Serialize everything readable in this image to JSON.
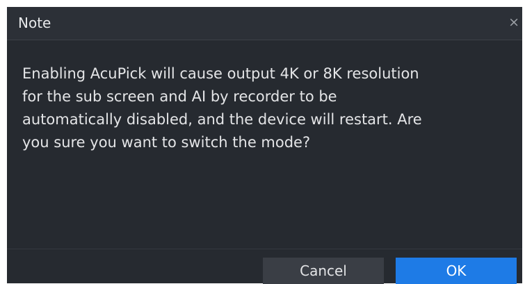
{
  "dialog": {
    "title": "Note",
    "close_symbol": "×",
    "message_lines": [
      "Enabling AcuPick will cause output 4K or 8K resolution",
      "for the sub screen and AI by recorder to be",
      "automatically disabled, and the device will restart. Are",
      "you sure you want to switch the mode?"
    ],
    "buttons": {
      "cancel_label": "Cancel",
      "ok_label": "OK"
    }
  },
  "colors": {
    "dialog_background": "#262a30",
    "title_bar_background": "#2c3037",
    "cancel_button": "#3a3e45",
    "ok_button_accent": "#1e7be6"
  },
  "icons": {
    "close": "close-icon"
  }
}
